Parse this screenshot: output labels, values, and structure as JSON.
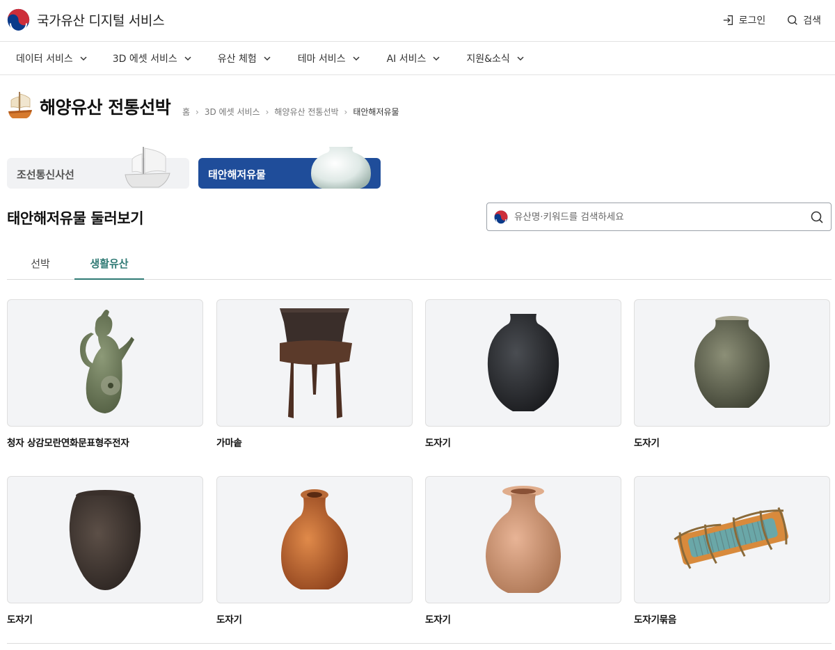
{
  "header": {
    "site_title": "국가유산 디지털 서비스",
    "login_label": "로그인",
    "search_label": "검색"
  },
  "nav": {
    "items": [
      {
        "label": "데이터 서비스"
      },
      {
        "label": "3D 에셋 서비스"
      },
      {
        "label": "유산 체험"
      },
      {
        "label": "테마 서비스"
      },
      {
        "label": "AI 서비스"
      },
      {
        "label": "지원&소식"
      }
    ]
  },
  "page": {
    "title": "해양유산 전통선박",
    "breadcrumb": [
      "홈",
      "3D 에셋 서비스",
      "해양유산 전통선박",
      "태안해저유물"
    ]
  },
  "categories": [
    {
      "label": "조선통신사선",
      "active": false
    },
    {
      "label": "태안해저유물",
      "active": true
    }
  ],
  "section": {
    "title": "태안해저유물 둘러보기",
    "search_placeholder": "유산명·키워드를 검색하세요"
  },
  "tabs": [
    {
      "label": "선박",
      "active": false
    },
    {
      "label": "생활유산",
      "active": true
    }
  ],
  "items": [
    {
      "name": "청자 상감모란연화문표형주전자",
      "icon": "celadon-ewer-icon"
    },
    {
      "name": "가마솥",
      "icon": "iron-cauldron-icon"
    },
    {
      "name": "도자기",
      "icon": "black-jar-icon"
    },
    {
      "name": "도자기",
      "icon": "green-jar-icon"
    },
    {
      "name": "도자기",
      "icon": "brown-jar-icon"
    },
    {
      "name": "도자기",
      "icon": "orange-bottle-icon"
    },
    {
      "name": "도자기",
      "icon": "tan-vase-icon"
    },
    {
      "name": "도자기묶음",
      "icon": "ceramics-bundle-icon"
    }
  ],
  "colors": {
    "accent_blue": "#1f4d9a",
    "tab_active": "#2f7a74"
  }
}
